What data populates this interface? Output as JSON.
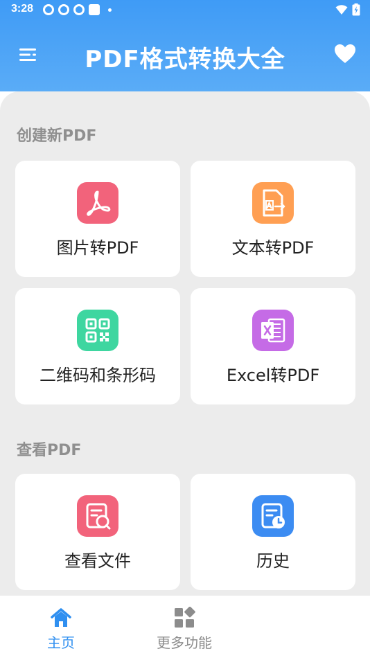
{
  "status_bar": {
    "time": "3:28"
  },
  "header": {
    "title": "PDF格式转换大全"
  },
  "sections": [
    {
      "title": "创建新PDF",
      "cards": [
        {
          "label": "图片转PDF",
          "icon": "pdf-acrobat-icon",
          "color": "#f2637b"
        },
        {
          "label": "文本转PDF",
          "icon": "document-to-pdf-icon",
          "color": "#ff9f53"
        },
        {
          "label": "二维码和条形码",
          "icon": "qr-code-icon",
          "color": "#3ed6a0"
        },
        {
          "label": "Excel转PDF",
          "icon": "excel-icon",
          "color": "#c56be6"
        }
      ]
    },
    {
      "title": "查看PDF",
      "cards": [
        {
          "label": "查看文件",
          "icon": "file-search-icon",
          "color": "#f2637b"
        },
        {
          "label": "历史",
          "icon": "history-clock-icon",
          "color": "#3c8cf2"
        }
      ]
    }
  ],
  "bottom_nav": [
    {
      "label": "主页",
      "icon": "home-icon",
      "active": true
    },
    {
      "label": "更多功能",
      "icon": "grid-icon",
      "active": false
    }
  ],
  "colors": {
    "header": "#3f9bf6",
    "active_nav": "#2f8ff0",
    "inactive_nav": "#8c8c8c",
    "background": "#ececec"
  }
}
